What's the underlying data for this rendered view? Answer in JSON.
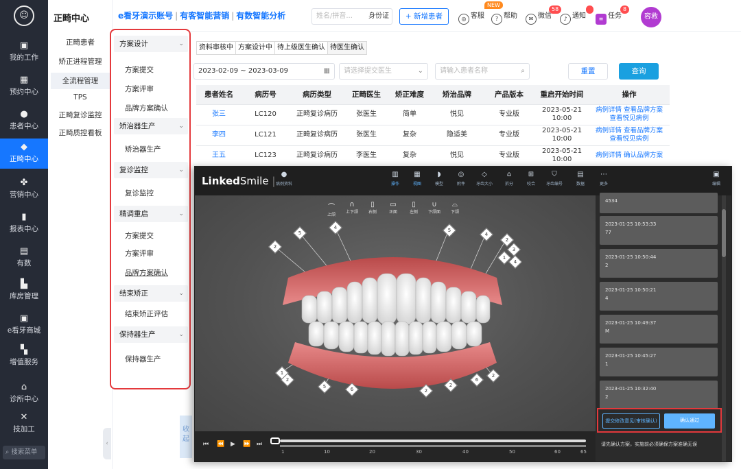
{
  "sidebar": {
    "logo": "☺",
    "items": [
      {
        "icon": "inbox-icon",
        "glyph": "▣",
        "label": "我的工作"
      },
      {
        "icon": "calendar-icon",
        "glyph": "▦",
        "label": "预约中心"
      },
      {
        "icon": "user-icon",
        "glyph": "●",
        "label": "患者中心"
      },
      {
        "icon": "tooth-icon",
        "glyph": "◆",
        "label": "正畸中心"
      },
      {
        "icon": "marketing-icon",
        "glyph": "✤",
        "label": "营销中心"
      },
      {
        "icon": "bar-chart-icon",
        "glyph": "▮",
        "label": "报表中心"
      },
      {
        "icon": "data-icon",
        "glyph": "▤",
        "label": "有数"
      },
      {
        "icon": "warehouse-icon",
        "glyph": "▙",
        "label": "库房管理"
      },
      {
        "icon": "shop-icon",
        "glyph": "▣",
        "label": "e看牙商城"
      },
      {
        "icon": "apps-icon",
        "glyph": "▚",
        "label": "增值服务"
      },
      {
        "icon": "clinic-icon",
        "glyph": "⌂",
        "label": "诊所中心"
      },
      {
        "icon": "tools-icon",
        "glyph": "✕",
        "label": "技加工"
      }
    ],
    "search_placeholder": "搜索菜单"
  },
  "submenu": {
    "title": "正畸中心",
    "items": [
      "正畸患者",
      "矫正进程管理",
      "全流程管理",
      "TPS",
      "正畸复诊监控",
      "正畸质控看板"
    ]
  },
  "header": {
    "brand": "e看牙演示账号",
    "marketing": "有客智能营销",
    "analysis": "有数智能分析",
    "search_placeholder": "姓名/拼音...",
    "idcard": "身份证",
    "new_patient": "+ 新增患者",
    "service": "客服",
    "help": "帮助",
    "new_tag": "NEW",
    "wechat": "微信",
    "wechat_badge": "58",
    "notice": "通知",
    "task": "任务",
    "task_badge": "8",
    "avatar": "容救"
  },
  "workflow": {
    "sections": [
      {
        "title": "方案设计",
        "items": [
          "方案提交",
          "方案评审",
          "品牌方案确认"
        ]
      },
      {
        "title": "矫治器生产",
        "items": [
          "矫治器生产"
        ]
      },
      {
        "title": "复诊监控",
        "items": [
          "复诊监控"
        ]
      },
      {
        "title": "精调重启",
        "items": [
          "方案提交",
          "方案评审",
          "品牌方案确认"
        ]
      },
      {
        "title": "结束矫正",
        "items": [
          "结束矫正评估"
        ]
      },
      {
        "title": "保持器生产",
        "items": [
          "保持器生产"
        ]
      }
    ],
    "chevron": "⌄"
  },
  "main": {
    "tabs": [
      "资料审核中",
      "方案设计中",
      "待上级医生确认",
      "待医生确认"
    ],
    "date_range": "2023-02-09 ~ 2023-03-09",
    "doctor_placeholder": "请选择提交医生",
    "patient_placeholder": "请输入患者名称",
    "reset": "重置",
    "query": "查询",
    "columns": [
      "患者姓名",
      "病历号",
      "病历类型",
      "正畸医生",
      "矫正难度",
      "矫治品牌",
      "产品版本",
      "重启开始时间",
      "操作"
    ],
    "rows": [
      {
        "name": "张三",
        "id": "LC120",
        "type": "正畸复诊病历",
        "doctor": "张医生",
        "level": "简单",
        "brand": "悦见",
        "version": "专业版",
        "date": "2023-05-21",
        "time": "10:00",
        "op1": "病例详情  查看品牌方案",
        "op2": "查看悦见病例"
      },
      {
        "name": "李四",
        "id": "LC121",
        "type": "正畸复诊病历",
        "doctor": "张医生",
        "level": "复杂",
        "brand": "隐适美",
        "version": "专业版",
        "date": "2023-05-21",
        "time": "10:00",
        "op1": "病例详情  查看品牌方案",
        "op2": "查看悦见病例"
      },
      {
        "name": "王五",
        "id": "LC123",
        "type": "正畸复诊病历",
        "doctor": "李医生",
        "level": "复杂",
        "brand": "悦见",
        "version": "专业版",
        "date": "2023-05-21",
        "time": "10:00",
        "op1": "病例详情  确认品牌方案",
        "op2": ""
      }
    ]
  },
  "viewer": {
    "logo_a": "Linked",
    "logo_b": "Smile",
    "patient_cap": "病例资料",
    "tools": [
      "操作",
      "视图",
      "模型",
      "附件",
      "牙齿大小",
      "拆分",
      "咬合",
      "牙齿编号",
      "数据",
      "更多"
    ],
    "right_tool": "编辑",
    "views": [
      "上颌",
      "上下颌",
      "右侧",
      "正面",
      "左侧",
      "下颌面",
      "下颌"
    ],
    "tooth_numbers": [
      "2",
      "5",
      "4",
      "5",
      "4",
      "2",
      "3",
      "1",
      "4",
      "1",
      "2",
      "5",
      "6",
      "2",
      "2",
      "6",
      "2"
    ],
    "ticks": [
      "1",
      "10",
      "20",
      "30",
      "40",
      "50",
      "60",
      "65"
    ],
    "history": [
      {
        "time": "",
        "value": "4534"
      },
      {
        "time": "2023-01-25 10:53:33",
        "value": "77"
      },
      {
        "time": "2023-01-25 10:50:44",
        "value": "2"
      },
      {
        "time": "2023-01-25 10:50:21",
        "value": "4"
      },
      {
        "time": "2023-01-25 10:49:37",
        "value": "M"
      },
      {
        "time": "2023-01-25 10:45:27",
        "value": "1"
      },
      {
        "time": "2023-01-25 10:32:40",
        "value": "2"
      }
    ],
    "btn_a": "提交修改意见(审核确认)",
    "btn_b": "确认通过",
    "note": "请先确认方案，实施前必须确保方案准确无误"
  },
  "shou": "收起"
}
